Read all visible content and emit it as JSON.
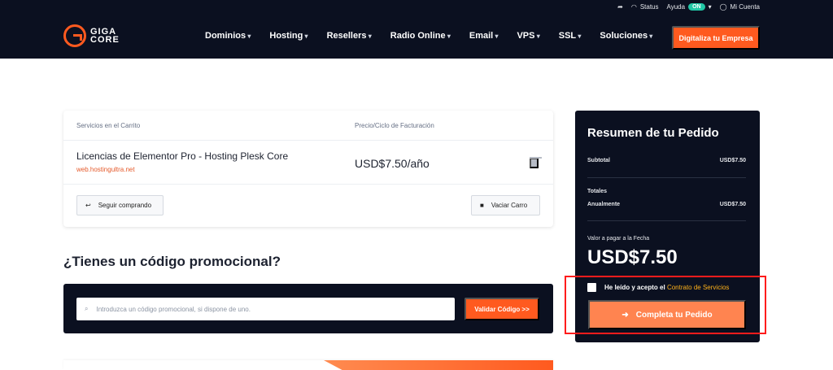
{
  "topbar": {
    "status": "Status",
    "help": "Ayuda",
    "toggle": "ON",
    "account": "Mi Cuenta"
  },
  "brand": {
    "line1": "GIGA",
    "line2": "CORE",
    "accent": "#ff5a1f",
    "dark": "#0b1020"
  },
  "nav": [
    "Dominios",
    "Hosting",
    "Resellers",
    "Radio Online",
    "Email",
    "VPS",
    "SSL",
    "Soluciones"
  ],
  "header_cta": "Digitaliza tu Empresa",
  "cart": {
    "headers": [
      "Servicios en el Carrito",
      "Precio/Ciclo de Facturación"
    ],
    "item_name": "Licencias de Elementor Pro - Hosting Plesk Core",
    "item_domain": "web.hostingultra.net",
    "item_price": "USD$7.50/año",
    "continue": "Seguir comprando",
    "empty": "Vaciar Carro"
  },
  "promo": {
    "title": "¿Tienes un código promocional?",
    "placeholder": "Introduzca un código promocional, si dispone de uno.",
    "button": "Validar Código >>"
  },
  "summary": {
    "title": "Resumen de tu Pedido",
    "subtotal_label": "Subtotal",
    "subtotal_value": "USD$7.50",
    "totals_label": "Totales",
    "annual_label": "Anualmente",
    "annual_value": "USD$7.50",
    "due_label": "Valor a pagar a la Fecha",
    "due_value": "USD$7.50",
    "terms_text": "He leído y acepto el",
    "terms_link": "Contrato de Servicios",
    "complete": "Completa tu Pedido"
  }
}
